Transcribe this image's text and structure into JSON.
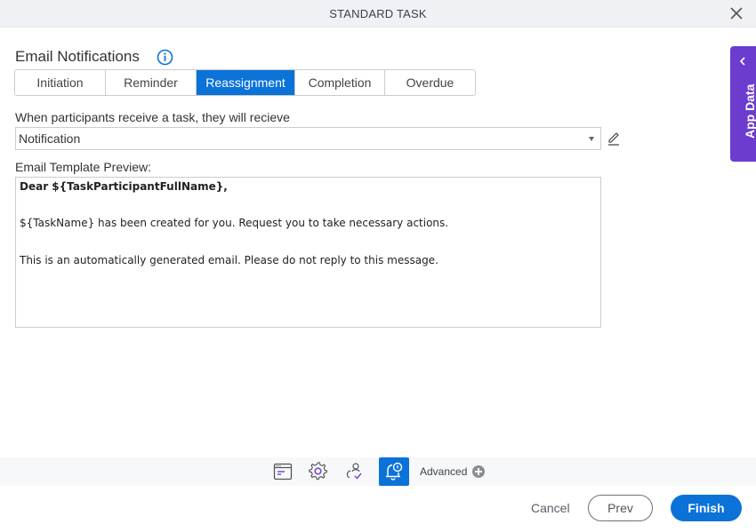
{
  "window": {
    "title": "STANDARD TASK",
    "close_icon": "close-icon"
  },
  "section": {
    "title": "Email Notifications",
    "info_icon": "info-icon"
  },
  "tabs": [
    {
      "label": "Initiation",
      "active": false
    },
    {
      "label": "Reminder",
      "active": false
    },
    {
      "label": "Reassignment",
      "active": true
    },
    {
      "label": "Completion",
      "active": false
    },
    {
      "label": "Overdue",
      "active": false
    }
  ],
  "receive": {
    "label": "When participants receive a task, they will recieve",
    "selected": "Notification",
    "edit_icon": "pencil-icon"
  },
  "preview": {
    "label": "Email Template Preview:",
    "lines": [
      "Dear ${TaskParticipantFullName},",
      "${TaskName} has been created for you. Request you to take necessary actions.",
      "This is an automatically generated email. Please do not reply to this message."
    ]
  },
  "app_data": {
    "label": "App Data",
    "icon": "chevron-left-icon"
  },
  "toolbar": {
    "icons": [
      {
        "name": "task-form-icon",
        "active": false
      },
      {
        "name": "gear-icon",
        "active": false
      },
      {
        "name": "participants-icon",
        "active": false
      },
      {
        "name": "notification-bell-icon",
        "active": true
      }
    ],
    "advanced_label": "Advanced"
  },
  "footer": {
    "cancel": "Cancel",
    "prev": "Prev",
    "finish": "Finish"
  },
  "colors": {
    "accent": "#0b72d8",
    "app_data_panel": "#6c3ccf",
    "icon_purple": "#7b45d6"
  }
}
